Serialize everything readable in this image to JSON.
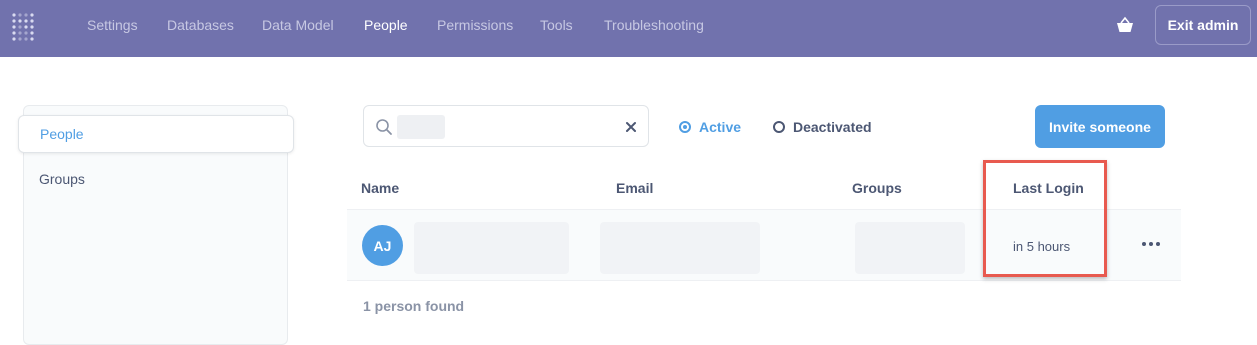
{
  "nav": {
    "items": [
      "Settings",
      "Databases",
      "Data Model",
      "People",
      "Permissions",
      "Tools",
      "Troubleshooting"
    ],
    "active": "People",
    "exit_label": "Exit admin",
    "logo_icon": "metabase-logo-icon",
    "store_icon": "store-icon"
  },
  "sidebar": {
    "items": [
      {
        "label": "People"
      },
      {
        "label": "Groups"
      }
    ]
  },
  "search": {
    "placeholder": "",
    "value_redacted": true
  },
  "filters": {
    "active_label": "Active",
    "deactivated_label": "Deactivated",
    "selected": "Active"
  },
  "invite_label": "Invite someone",
  "table": {
    "columns": [
      "Name",
      "Email",
      "Groups",
      "Last Login"
    ],
    "rows": [
      {
        "initials": "AJ",
        "last_login": "in 5 hours"
      }
    ]
  },
  "footer": {
    "count_text": "1 person found"
  },
  "colors": {
    "nav_bg": "#7172ad",
    "brand": "#509ee3",
    "highlight": "#e85a4f"
  }
}
